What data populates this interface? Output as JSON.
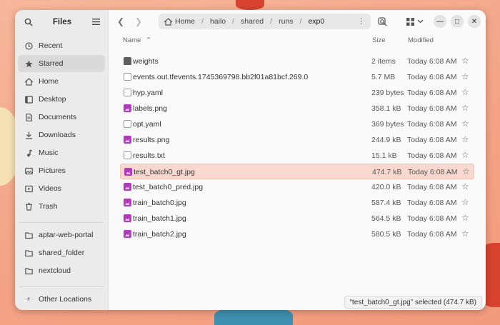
{
  "sidebar": {
    "title": "Files",
    "places": [
      {
        "label": "Recent",
        "icon": "clock-icon"
      },
      {
        "label": "Starred",
        "icon": "star-icon",
        "active": true
      },
      {
        "label": "Home",
        "icon": "home-icon"
      },
      {
        "label": "Desktop",
        "icon": "desktop-icon"
      },
      {
        "label": "Documents",
        "icon": "document-icon"
      },
      {
        "label": "Downloads",
        "icon": "download-icon"
      },
      {
        "label": "Music",
        "icon": "music-icon"
      },
      {
        "label": "Pictures",
        "icon": "picture-icon"
      },
      {
        "label": "Videos",
        "icon": "video-icon"
      },
      {
        "label": "Trash",
        "icon": "trash-icon"
      }
    ],
    "bookmarks": [
      {
        "label": "aptar-web-portal",
        "icon": "folder-icon"
      },
      {
        "label": "shared_folder",
        "icon": "folder-icon"
      },
      {
        "label": "nextcloud",
        "icon": "folder-icon"
      }
    ],
    "other": {
      "label": "Other Locations",
      "icon": "plus-icon"
    }
  },
  "path": {
    "crumbs": [
      "Home",
      "hailo",
      "shared",
      "runs",
      "exp0"
    ]
  },
  "columns": {
    "name": "Name",
    "size": "Size",
    "modified": "Modified"
  },
  "files": [
    {
      "name": "weights",
      "size": "2 items",
      "modified": "Today 6:08 AM",
      "type": "folder"
    },
    {
      "name": "events.out.tfevents.1745369798.bb2f01a81bcf.269.0",
      "size": "5.7 MB",
      "modified": "Today 6:08 AM",
      "type": "text"
    },
    {
      "name": "hyp.yaml",
      "size": "239 bytes",
      "modified": "Today 6:08 AM",
      "type": "text"
    },
    {
      "name": "labels.png",
      "size": "358.1 kB",
      "modified": "Today 6:08 AM",
      "type": "image"
    },
    {
      "name": "opt.yaml",
      "size": "369 bytes",
      "modified": "Today 6:08 AM",
      "type": "text"
    },
    {
      "name": "results.png",
      "size": "244.9 kB",
      "modified": "Today 6:08 AM",
      "type": "image"
    },
    {
      "name": "results.txt",
      "size": "15.1 kB",
      "modified": "Today 6:08 AM",
      "type": "text"
    },
    {
      "name": "test_batch0_gt.jpg",
      "size": "474.7 kB",
      "modified": "Today 6:08 AM",
      "type": "image",
      "selected": true
    },
    {
      "name": "test_batch0_pred.jpg",
      "size": "420.0 kB",
      "modified": "Today 6:08 AM",
      "type": "image"
    },
    {
      "name": "train_batch0.jpg",
      "size": "587.4 kB",
      "modified": "Today 6:08 AM",
      "type": "image"
    },
    {
      "name": "train_batch1.jpg",
      "size": "564.5 kB",
      "modified": "Today 6:08 AM",
      "type": "image"
    },
    {
      "name": "train_batch2.jpg",
      "size": "580.5 kB",
      "modified": "Today 6:08 AM",
      "type": "image"
    }
  ],
  "status_text": "“test_batch0_gt.jpg” selected  (474.7 kB)",
  "colors": {
    "selection": "#f9d9cf",
    "image_icon": "#b13bbb"
  }
}
